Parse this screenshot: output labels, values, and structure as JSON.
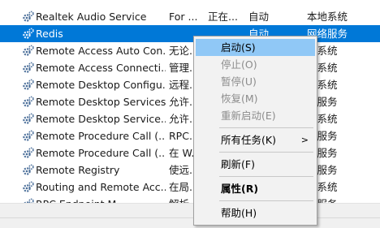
{
  "services": [
    {
      "name": "Realtek Audio Service",
      "description": "For ...",
      "status": "正在...",
      "startup": "自动",
      "logon": "本地系统"
    },
    {
      "name": "Redis",
      "description": "",
      "status": "",
      "startup": "自动",
      "logon": "网络服务",
      "selected": true
    },
    {
      "name": "Remote Access Auto Con...",
      "description": "无论...",
      "status": "",
      "startup": "",
      "logon": "地系统"
    },
    {
      "name": "Remote Access Connecti...",
      "description": "管理...",
      "status": "",
      "startup": "",
      "logon": "地系统"
    },
    {
      "name": "Remote Desktop Configu...",
      "description": "远程...",
      "status": "",
      "startup": "",
      "logon": "地系统"
    },
    {
      "name": "Remote Desktop Services",
      "description": "允许...",
      "status": "",
      "startup": "",
      "logon": "络服务"
    },
    {
      "name": "Remote Desktop Service...",
      "description": "允许...",
      "status": "",
      "startup": "",
      "logon": "地系统"
    },
    {
      "name": "Remote Procedure Call (...",
      "description": "RPC...",
      "status": "",
      "startup": "",
      "logon": "络服务"
    },
    {
      "name": "Remote Procedure Call (...",
      "description": "在 W...",
      "status": "",
      "startup": "",
      "logon": "络服务"
    },
    {
      "name": "Remote Registry",
      "description": "使远...",
      "status": "",
      "startup": "",
      "logon": "地服务"
    },
    {
      "name": "Routing and Remote Acc...",
      "description": "在局...",
      "status": "",
      "startup": "",
      "logon": "地系统"
    },
    {
      "name": "RPC Endpoint M...",
      "description": "解析...",
      "status": "",
      "startup": "",
      "logon": "络服务"
    }
  ],
  "context_menu": {
    "items": [
      {
        "label": "启动(S)",
        "enabled": true,
        "highlight": true
      },
      {
        "label": "停止(O)",
        "enabled": false
      },
      {
        "label": "暂停(U)",
        "enabled": false
      },
      {
        "label": "恢复(M)",
        "enabled": false
      },
      {
        "label": "重新启动(E)",
        "enabled": false
      },
      {
        "separator": true
      },
      {
        "label": "所有任务(K)",
        "enabled": true,
        "submenu": true
      },
      {
        "separator": true
      },
      {
        "label": "刷新(F)",
        "enabled": true
      },
      {
        "separator": true
      },
      {
        "label": "属性(R)",
        "enabled": true,
        "bold": true
      },
      {
        "separator": true
      },
      {
        "label": "帮助(H)",
        "enabled": true
      }
    ],
    "submenu_arrow": ">"
  },
  "icons": {
    "service": "gear-icon"
  },
  "colors": {
    "selection": "#0078d7",
    "menu_highlight": "#90c8f6"
  }
}
